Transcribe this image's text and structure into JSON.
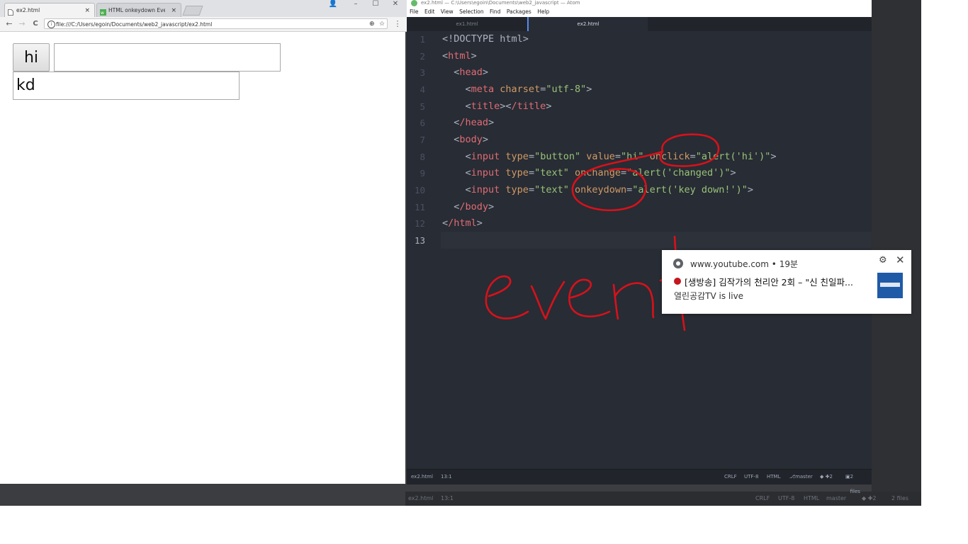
{
  "colors": {
    "annotation_red": "#d8111b",
    "atom_bg": "#282c34",
    "atom_tag": "#e06c75",
    "atom_attr": "#d19a66",
    "atom_string": "#98c379"
  },
  "chrome": {
    "tabs": [
      {
        "label": "ex2.html",
        "icon": "page-icon",
        "close": "×"
      },
      {
        "label": "HTML onkeydown Event",
        "icon": "w3schools-icon",
        "close": "×"
      }
    ],
    "window_controls": {
      "profile": "👤",
      "minimize": "–",
      "maximize": "☐",
      "close": "✕"
    },
    "nav": {
      "back": "←",
      "forward": "→",
      "reload": "C"
    },
    "url": "file:///C:/Users/egoin/Documents/web2_javascript/ex2.html",
    "url_info": "i",
    "zoom_icon": "⊕",
    "bookmark_icon": "☆",
    "menu_icon": "⋮",
    "page": {
      "button_value": "hi",
      "change_input_value": "",
      "keydown_input_value": "kd"
    }
  },
  "atom": {
    "title": "ex2.html — C:\\Users\\egoin\\Documents\\web2_javascript — Atom",
    "menu": [
      "File",
      "Edit",
      "View",
      "Selection",
      "Find",
      "Packages",
      "Help"
    ],
    "tabs": [
      "ex1.html",
      "ex2.html"
    ],
    "line_numbers": [
      "1",
      "2",
      "3",
      "4",
      "5",
      "6",
      "7",
      "8",
      "9",
      "10",
      "11",
      "12",
      "13"
    ],
    "code": {
      "l1": "<!DOCTYPE html>",
      "l2_tag": "html",
      "l3_tag": "head",
      "l4_tag": "meta",
      "l4_attr": "charset",
      "l4_val": "\"utf-8\"",
      "l5_tag1": "title",
      "l5_tag2": "/title",
      "l6_tag": "/head",
      "l7_tag": "body",
      "l8_tag": "input",
      "l8_a1": "type",
      "l8_v1": "\"button\"",
      "l8_a2": "value",
      "l8_v2": "\"hi\"",
      "l8_a3": "onclick",
      "l8_v3": "\"alert('hi')\"",
      "l9_tag": "input",
      "l9_a1": "type",
      "l9_v1": "\"text\"",
      "l9_a2": "onchange",
      "l9_v2": "\"alert('changed')\"",
      "l10_tag": "input",
      "l10_a1": "type",
      "l10_v1": "\"text\"",
      "l10_a2": "onkeydown",
      "l10_v2": "\"alert('key down!')\"",
      "l11_tag": "/body",
      "l12_tag": "/html"
    },
    "status": {
      "file": "ex2.html",
      "cursor": "13:1",
      "line_ending": "CRLF",
      "encoding": "UTF-8",
      "grammar": "HTML",
      "branch": "master",
      "git_arrows": "◆ ✚2",
      "files": "2 files"
    }
  },
  "ghost_status": {
    "file": "ex2.html",
    "cursor": "13:1",
    "line_ending": "CRLF",
    "encoding": "UTF-8",
    "grammar": "HTML",
    "branch": "master",
    "git": "◆ ✚2",
    "files": "2 files"
  },
  "notification": {
    "source": "www.youtube.com",
    "time": "19분",
    "title": "[생방송] 김작가의 천리안 2회 – \"신 친일파...",
    "message": "열린공감TV is live",
    "settings_icon": "⚙",
    "close_icon": "✕"
  }
}
